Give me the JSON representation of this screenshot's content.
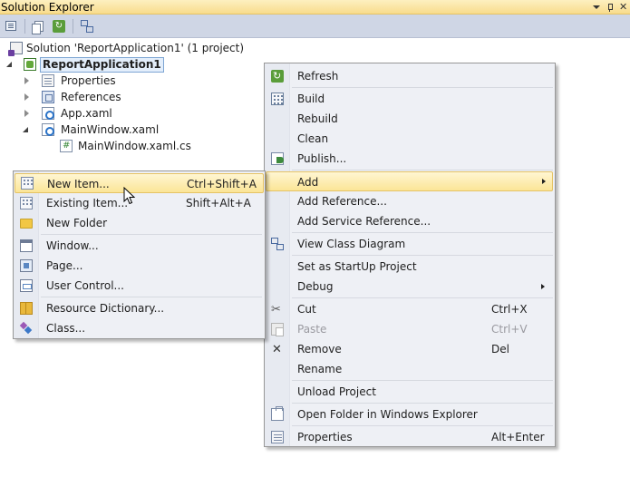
{
  "window": {
    "title": "Solution Explorer",
    "title_buttons": [
      "dropdown-icon",
      "pin-icon",
      "close-icon"
    ]
  },
  "toolbar": {
    "buttons": [
      "properties-icon",
      "show-all-files-icon",
      "refresh-icon",
      "view-class-diagram-icon"
    ]
  },
  "tree": {
    "solution": "Solution 'ReportApplication1' (1 project)",
    "project": "ReportApplication1",
    "properties": "Properties",
    "references": "References",
    "app_xaml": "App.xaml",
    "mainwindow_xaml": "MainWindow.xaml",
    "mainwindow_cs": "MainWindow.xaml.cs"
  },
  "context_menu": {
    "refresh": "Refresh",
    "build": "Build",
    "rebuild": "Rebuild",
    "clean": "Clean",
    "publish": "Publish...",
    "add": "Add",
    "add_reference": "Add Reference...",
    "add_service_reference": "Add Service Reference...",
    "view_class_diagram": "View Class Diagram",
    "set_startup": "Set as StartUp Project",
    "debug": "Debug",
    "cut": "Cut",
    "cut_shortcut": "Ctrl+X",
    "paste": "Paste",
    "paste_shortcut": "Ctrl+V",
    "remove": "Remove",
    "remove_shortcut": "Del",
    "rename": "Rename",
    "unload": "Unload Project",
    "open_folder": "Open Folder in Windows Explorer",
    "properties": "Properties",
    "properties_shortcut": "Alt+Enter"
  },
  "add_submenu": {
    "new_item": "New Item...",
    "new_item_shortcut": "Ctrl+Shift+A",
    "existing_item": "Existing Item...",
    "existing_item_shortcut": "Shift+Alt+A",
    "new_folder": "New Folder",
    "window": "Window...",
    "page": "Page...",
    "user_control": "User Control...",
    "resource_dictionary": "Resource Dictionary...",
    "class": "Class..."
  },
  "colors": {
    "title_bar": "#f8dc8c",
    "toolbar": "#cfd6e5",
    "menu_background": "#eef0f5",
    "highlight": "#fbe596"
  }
}
